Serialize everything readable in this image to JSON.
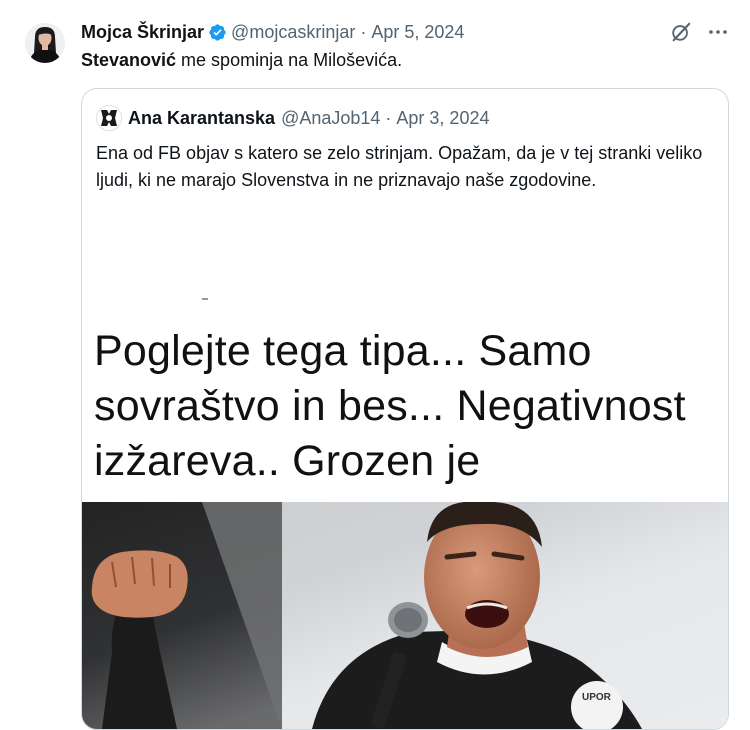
{
  "tweet": {
    "author_name": "Mojca Škrinjar",
    "author_handle": "@mojcaskrinjar",
    "separator": "·",
    "date": "Apr 5, 2024",
    "text_bold": "Stevanović",
    "text_rest": " me spominja na Miloševića."
  },
  "quote": {
    "author_name": "Ana Karantanska",
    "author_handle": "@AnaJob14",
    "separator": "·",
    "date": "Apr 3, 2024",
    "text": "Ena od FB objav s katero se zelo strinjam. Opažam, da je v tej stranki veliko ljudi, ki ne marajo Slovenstva in ne priznavajo naše zgodovine.",
    "image_caption_lines": [
      "Poglejte tega tipa... Samo",
      "sovraštvo in bes... Negativnost",
      "izžareva.. Grozen je"
    ],
    "badge_text": "UPOR"
  },
  "colors": {
    "accent": "#1d9bf0",
    "secondary_text": "#536471",
    "border": "#cfd9de"
  },
  "icons": {
    "verified": "verified-badge-icon",
    "grok": "grok-icon",
    "more": "more-icon"
  }
}
